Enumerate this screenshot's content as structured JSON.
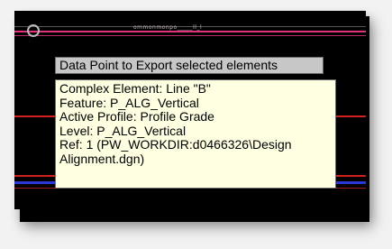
{
  "prompt": {
    "text": "Data Point to Export selected elements"
  },
  "faint_label": "ommonmonpo_____ll_l",
  "tooltip": {
    "lines": [
      "Complex Element: Line \"B\"",
      "Feature: P_ALG_Vertical",
      "Active Profile: Profile Grade",
      "Level: P_ALG_Vertical",
      "Ref: 1 (PW_WORKDIR:d0466326\\Design",
      "Alignment.dgn)"
    ]
  },
  "colors": {
    "canvas_background": "#000000",
    "tooltip_background": "#ffffe1",
    "prompt_background": "#c7c7c7",
    "pink_line": "#e0337a",
    "red_line": "#d21f1f",
    "blue_line": "#2b38d8"
  },
  "icons": {
    "cursor": "cursor-circle-icon"
  }
}
